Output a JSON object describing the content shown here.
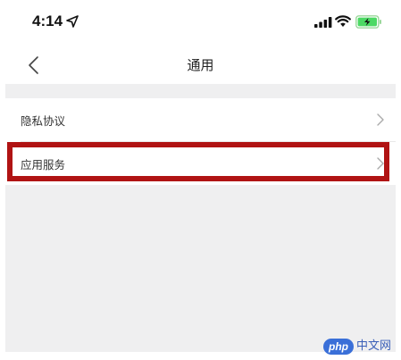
{
  "status_bar": {
    "time": "4:14",
    "icons": [
      "location-arrow-icon",
      "signal-bars-icon",
      "wifi-icon",
      "battery-charging-icon"
    ]
  },
  "nav": {
    "back_icon": "chevron-left-icon",
    "title": "通用"
  },
  "list": {
    "items": [
      {
        "label": "隐私协议",
        "icon": "chevron-right-icon"
      },
      {
        "label": "应用服务",
        "icon": "chevron-right-icon"
      }
    ]
  },
  "watermark": {
    "logo": "php",
    "text": "中文网"
  },
  "colors": {
    "highlight": "#b01313",
    "background": "#efeff0",
    "battery": "#4cd964"
  }
}
